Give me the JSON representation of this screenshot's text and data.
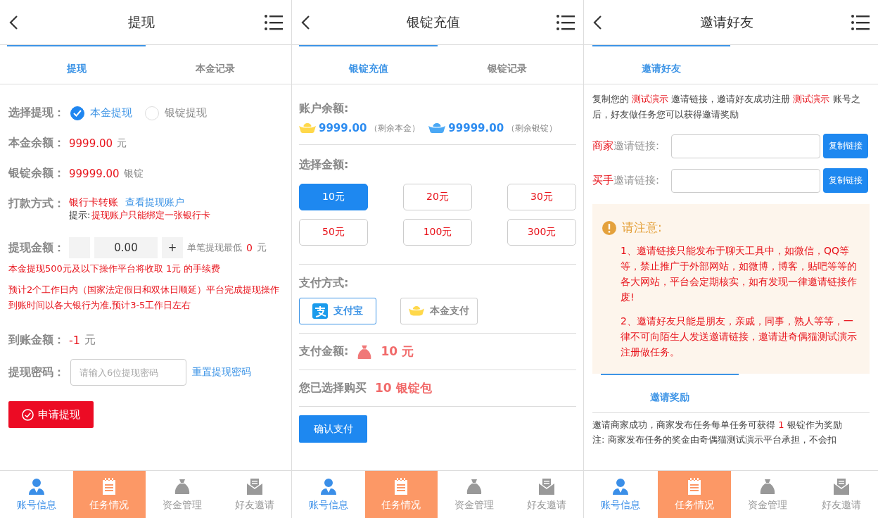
{
  "withdraw": {
    "title": "提现",
    "tabs": [
      {
        "label": "提现",
        "selected": true
      },
      {
        "label": "本金记录",
        "selected": false
      }
    ],
    "choice": {
      "label": "选择提现：",
      "options": [
        {
          "label": "本金提现",
          "selected": true
        },
        {
          "label": "银锭提现",
          "selected": false
        }
      ]
    },
    "balances": [
      {
        "label": "本金余额：",
        "value": "9999.00",
        "unit": "元"
      },
      {
        "label": "银锭余额：",
        "value": "99999.00",
        "unit": "银锭"
      }
    ],
    "payout": {
      "label": "打款方式：",
      "method": "银行卡转账",
      "link": "查看提现账户",
      "hint_label": "提示:",
      "hint": "提现账户只能绑定一张银行卡"
    },
    "amount": {
      "label": "提现金额：",
      "value": "0.00",
      "plus": "+",
      "min_label": "单笔提现最低",
      "min_value": "0",
      "min_unit": "元"
    },
    "fee_note": "本金提现500元及以下操作平台将收取 1元 的手续费",
    "notice": "预计2个工作日内（国家法定假日和双休日顺延）平台完成提现操作到账时间以各大银行为准,预计3-5工作日左右",
    "arrival": {
      "label": "到账金额：",
      "value": "-1",
      "unit": "元"
    },
    "password": {
      "label": "提现密码：",
      "placeholder": "请输入6位提现密码",
      "link": "重置提现密码"
    },
    "submit": "申请提现",
    "nav": [
      {
        "label": "账号信息",
        "selected": false,
        "highlighted": true
      },
      {
        "label": "任务情况",
        "selected": true,
        "highlighted": false
      },
      {
        "label": "资金管理",
        "selected": false,
        "highlighted": false
      },
      {
        "label": "好友邀请",
        "selected": false,
        "highlighted": false
      }
    ]
  },
  "recharge": {
    "title": "银锭充值",
    "tabs": [
      {
        "label": "银锭充值",
        "selected": true
      },
      {
        "label": "银锭记录",
        "selected": false
      }
    ],
    "balance": {
      "label": "账户余额:",
      "items": [
        {
          "value": "9999.00",
          "note": "（剩余本金）",
          "color": "#ffd84a"
        },
        {
          "value": "99999.00",
          "note": "（剩余银锭）",
          "color": "#4aa8f5"
        }
      ]
    },
    "amounts": {
      "label": "选择金额:",
      "options": [
        {
          "label": "10元",
          "selected": true
        },
        {
          "label": "20元",
          "selected": false
        },
        {
          "label": "30元",
          "selected": false
        },
        {
          "label": "50元",
          "selected": false
        },
        {
          "label": "100元",
          "selected": false
        },
        {
          "label": "300元",
          "selected": false
        }
      ]
    },
    "payment": {
      "label": "支付方式:",
      "methods": [
        {
          "label": "支付宝",
          "selected": true
        },
        {
          "label": "本金支付",
          "selected": false
        }
      ]
    },
    "total": {
      "label": "支付金额:",
      "value": "10 元"
    },
    "purchase": {
      "label": "您已选择购买",
      "value": "10 银锭包"
    },
    "confirm": "确认支付",
    "nav": [
      {
        "label": "账号信息",
        "selected": false,
        "highlighted": true
      },
      {
        "label": "任务情况",
        "selected": true,
        "highlighted": false
      },
      {
        "label": "资金管理",
        "selected": false,
        "highlighted": false
      },
      {
        "label": "好友邀请",
        "selected": false,
        "highlighted": false
      }
    ]
  },
  "invite": {
    "title": "邀请好友",
    "tabs": [
      {
        "label": "邀请好友",
        "selected": true
      }
    ],
    "intro": [
      {
        "text": "复制您的 ",
        "highlight": false
      },
      {
        "text": "测试演示",
        "highlight": true
      },
      {
        "text": " 邀请链接，邀请好友成功注册 ",
        "highlight": false
      },
      {
        "text": "测试演示",
        "highlight": true
      },
      {
        "text": " 账号之后，好友做任务您可以获得邀请奖励",
        "highlight": false
      }
    ],
    "links": [
      {
        "role": "商家",
        "label": "邀请链接:",
        "button": "复制链接"
      },
      {
        "role": "买手",
        "label": "邀请链接:",
        "button": "复制链接"
      }
    ],
    "notice": {
      "title": "请注意:",
      "items": [
        "1、邀请链接只能发布于聊天工具中，如微信，QQ等等，禁止推广于外部网站，如微博，博客，贴吧等等的各大网站，平台会定期核实，如有发现一律邀请链接作废!",
        "2、邀请好友只能是朋友，亲戚，同事，熟人等等，一律不可向陌生人发送邀请链接，邀请进奇偶猫测试演示注册做任务。"
      ]
    },
    "reward_tabs": [
      {
        "label": "邀请奖励",
        "selected": true
      }
    ],
    "reward": [
      {
        "text": "邀请商家成功，商家发布任务每单任务可获得 ",
        "highlight": false
      },
      {
        "text": "1",
        "highlight": true
      },
      {
        "text": " 银锭作为奖励",
        "highlight": false
      }
    ],
    "reward_note": "注: 商家发布任务的奖金由奇偶猫测试演示平台承担，不会扣",
    "nav": [
      {
        "label": "账号信息",
        "selected": false,
        "highlighted": true
      },
      {
        "label": "任务情况",
        "selected": true,
        "highlighted": false
      },
      {
        "label": "资金管理",
        "selected": false,
        "highlighted": false
      },
      {
        "label": "好友邀请",
        "selected": false,
        "highlighted": false
      }
    ]
  }
}
